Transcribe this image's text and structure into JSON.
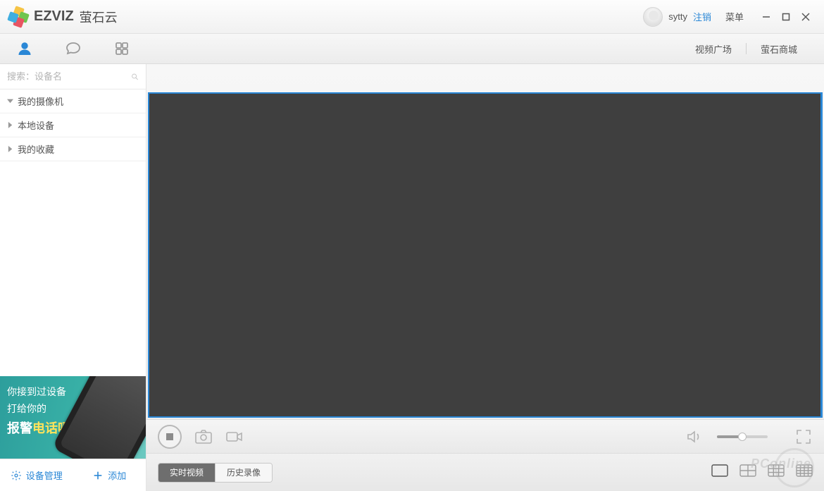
{
  "titlebar": {
    "brand": "EZVIZ",
    "brand_sub": "萤石云",
    "username": "sytty",
    "logout": "注销",
    "menu": "菜单"
  },
  "secondbar": {
    "link_plaza": "视频广场",
    "link_mall": "萤石商城"
  },
  "sidebar": {
    "search_placeholder": "搜索：设备名",
    "tree": {
      "cameras": "我的摄像机",
      "local": "本地设备",
      "favorites": "我的收藏"
    },
    "promo": {
      "line1": "你接到过设备",
      "line2": "打给你的",
      "line3a": "报警",
      "line3b": "电话吗？"
    },
    "device_mgmt": "设备管理",
    "add": "添加"
  },
  "content": {
    "tabs": {
      "live": "实时视频",
      "history": "历史录像"
    }
  },
  "watermark": "PConline"
}
